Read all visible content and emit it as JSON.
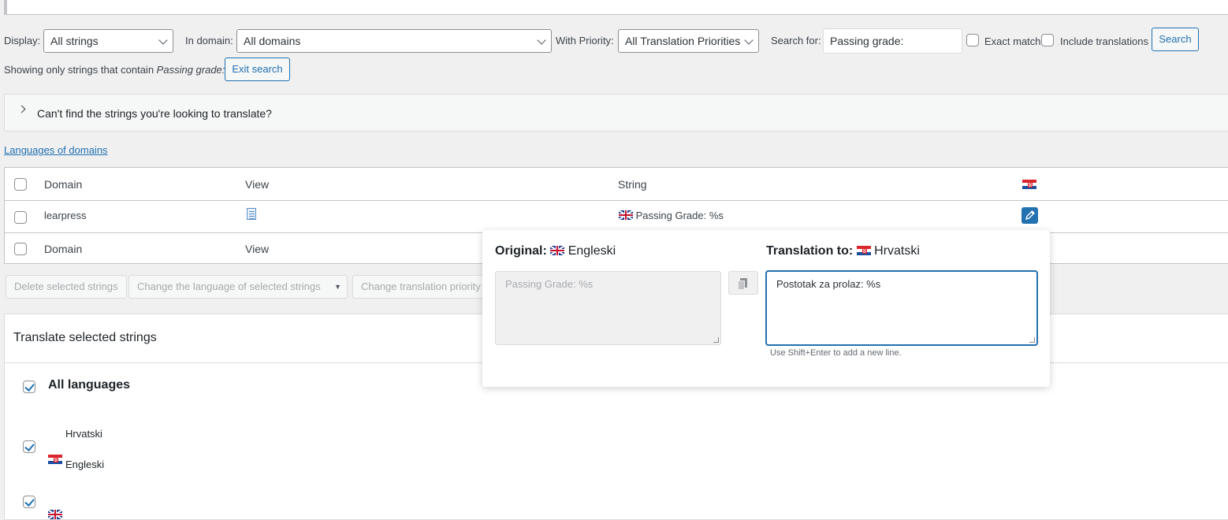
{
  "filters": {
    "display_label": "Display:",
    "display_value": "All strings",
    "domain_label": "In domain:",
    "domain_value": "All domains",
    "priority_label": "With Priority:",
    "priority_value": "All Translation Priorities",
    "search_label": "Search for:",
    "search_value": "Passing grade:",
    "exact_match_label": "Exact match",
    "include_translations_label": "Include translations",
    "search_button": "Search"
  },
  "search_status": {
    "prefix": "Showing only strings that contain ",
    "term": "Passing grade:",
    "exit_button": "Exit search"
  },
  "help_panel": {
    "text": "Can't find the strings you're looking to translate?"
  },
  "languages_link": "Languages of domains",
  "table": {
    "header": {
      "domain": "Domain",
      "view": "View",
      "string": "String"
    },
    "rows": [
      {
        "domain": "learpress",
        "string": "Passing Grade: %s"
      }
    ],
    "footer": {
      "domain": "Domain",
      "view": "View"
    }
  },
  "bulk_actions": {
    "delete": "Delete selected strings",
    "change_language": "Change the language of selected strings",
    "change_priority": "Change translation priority"
  },
  "translate_panel": {
    "title": "Translate selected strings",
    "all_languages": "All languages",
    "languages": [
      "Hrvatski",
      "Engleski"
    ]
  },
  "popup": {
    "original_label": "Original:",
    "original_lang": "Engleski",
    "original_text": "Passing Grade: %s",
    "translation_label": "Translation to:",
    "translation_lang": "Hrvatski",
    "translation_text": "Postotak za prolaz: %s",
    "hint": "Use Shift+Enter to add a new line."
  }
}
